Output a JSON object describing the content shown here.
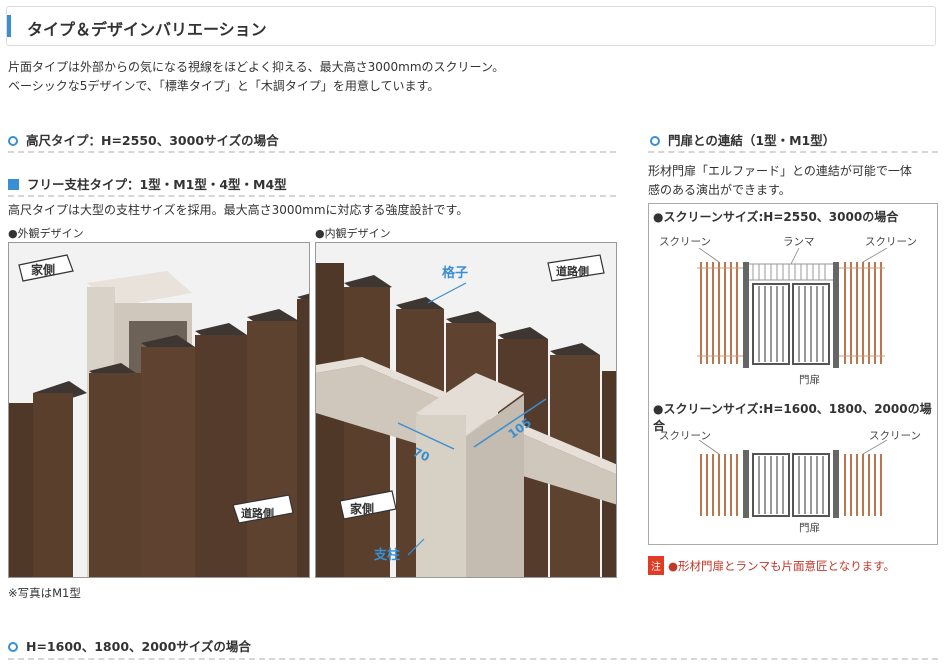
{
  "title": "タイプ＆デザインバリエーション",
  "intro": {
    "line1": "片面タイプは外部からの気になる視線をほどよく抑える、最大高さ3000mmのスクリーン。",
    "line2": "ベーシックな5デザインで、「標準タイプ」と「木調タイプ」を用意しています。"
  },
  "section_tall": {
    "heading": "高尺タイプ：H=2550、3000サイズの場合",
    "subheading": "フリー支柱タイプ：1型・M1型・4型・M4型",
    "description": "高尺タイプは大型の支柱サイズを採用。最大高さ3000mmに対応する強度設計です。",
    "photo1_label": "●外観デザイン",
    "photo2_label": "●内観デザイン",
    "photo_note": "※写真はM1型",
    "photo1_tags": {
      "house": "家側",
      "road": "道路側"
    },
    "photo2_tags": {
      "lattice": "格子",
      "road": "道路側",
      "house": "家側",
      "post": "支柱",
      "dim_70": "70",
      "dim_105": "105"
    }
  },
  "section_gate": {
    "heading": "門扉との連結（1型・M1型）",
    "description_line1": "形材門扉「エルファード」との連結が可能で一体",
    "description_line2": "感のある演出ができます。",
    "diagram1_title": "●スクリーンサイズ:H=2550、3000の場合",
    "diagram2_title": "●スクリーンサイズ:H=1600、1800、2000の場合",
    "screen_label": "スクリーン",
    "ramma_label": "ランマ",
    "gate_label": "門扉",
    "note_badge": "注",
    "note_text": "●形材門扉とランマも片面意匠となります。"
  },
  "section_short": {
    "heading": "H=1600、1800、2000サイズの場合"
  },
  "colors": {
    "accent": "#3a8fd3",
    "wood": "#b9764f",
    "post_dark": "#4a3427",
    "note_red": "#e03b24"
  }
}
